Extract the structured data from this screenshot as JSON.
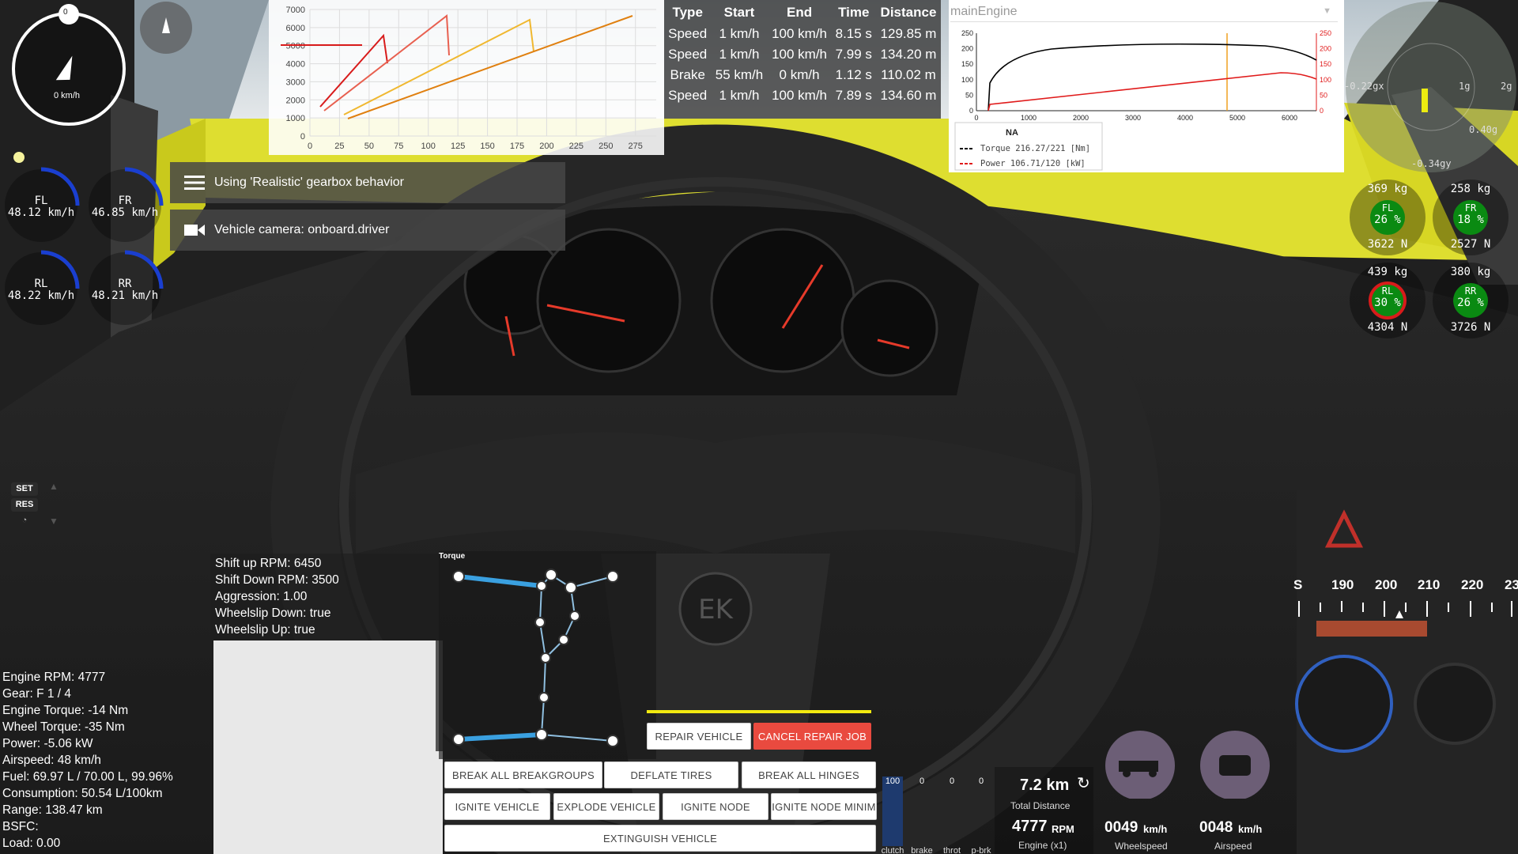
{
  "speedometer": {
    "speed": "0 km/h",
    "gear_marker": "0"
  },
  "shift_chart": {
    "y_ticks": [
      "7000",
      "6000",
      "5000",
      "4000",
      "3000",
      "2000",
      "1000",
      "0"
    ],
    "x_ticks": [
      "0",
      "25",
      "50",
      "75",
      "100",
      "125",
      "150",
      "175",
      "200",
      "225",
      "250",
      "275"
    ]
  },
  "perf_table": {
    "headers": [
      "Type",
      "Start",
      "End",
      "Time",
      "Distance"
    ],
    "rows": [
      [
        "Speed",
        "1 km/h",
        "100 km/h",
        "8.15 s",
        "129.85 m"
      ],
      [
        "Speed",
        "1 km/h",
        "100 km/h",
        "7.99 s",
        "134.20 m"
      ],
      [
        "Brake",
        "55 km/h",
        "0 km/h",
        "1.12 s",
        "110.02 m"
      ],
      [
        "Speed",
        "1 km/h",
        "100 km/h",
        "7.89 s",
        "134.60 m"
      ]
    ]
  },
  "engine_graph": {
    "selector": "mainEngine",
    "left_ticks": [
      "250",
      "200",
      "150",
      "100",
      "50",
      "0"
    ],
    "right_ticks": [
      "250",
      "200",
      "150",
      "100",
      "50",
      "0"
    ],
    "x_ticks": [
      "0",
      "1000",
      "2000",
      "3000",
      "4000",
      "5000",
      "6000"
    ],
    "legend_title": "NA",
    "torque_label": "Torque 216.27/221 [Nm]",
    "power_label": "Power  106.71/120 [kW]",
    "torque_color": "#000000",
    "power_color": "#e01b1b",
    "marker_color": "#f0a020"
  },
  "notifications": [
    {
      "icon": "menu-icon",
      "text": "Using 'Realistic' gearbox behavior"
    },
    {
      "icon": "camera-icon",
      "text": "Vehicle camera: onboard.driver"
    }
  ],
  "wheel_speeds": [
    {
      "pos": "FL",
      "speed": "48.12 km/h"
    },
    {
      "pos": "FR",
      "speed": "46.85 km/h"
    },
    {
      "pos": "RL",
      "speed": "48.22 km/h"
    },
    {
      "pos": "RR",
      "speed": "48.21 km/h"
    }
  ],
  "gforce": {
    "x_label": "-0.22gx",
    "g1": "1g",
    "g2": "2g",
    "right_val": "0.40g",
    "y_label": "-0.34gy"
  },
  "tires": [
    {
      "pos": "FL",
      "mass": "369 kg",
      "pct": "26 %",
      "force": "3622 N"
    },
    {
      "pos": "FR",
      "mass": "258 kg",
      "pct": "18 %",
      "force": "2527 N"
    },
    {
      "pos": "RL",
      "mass": "439 kg",
      "pct": "30 %",
      "force": "4304 N"
    },
    {
      "pos": "RR",
      "mass": "380 kg",
      "pct": "26 %",
      "force": "3726 N"
    }
  ],
  "cruise": {
    "set": "SET",
    "res": "RES"
  },
  "shift_info": [
    "Shift up RPM: 6450",
    "Shift Down RPM: 3500",
    "Aggression: 1.00",
    "Wheelslip Down: true",
    "Wheelslip Up: true"
  ],
  "engine_stats": [
    "Engine RPM: 4777",
    "Gear: F 1 / 4",
    "Engine Torque: -14 Nm",
    "Wheel Torque: -35 Nm",
    "Power: -5.06 kW",
    "Airspeed: 48 km/h",
    "Fuel: 69.97 L / 70.00 L, 99.96%",
    "Consumption: 50.54 L/100km",
    "Range: 138.47 km",
    "BSFC:",
    "Load: 0.00"
  ],
  "node_graph": {
    "title": "Torque"
  },
  "buttons": {
    "repair": "REPAIR VEHICLE",
    "cancel_repair": "CANCEL REPAIR JOB",
    "break_groups": "BREAK ALL BREAKGROUPS",
    "deflate": "DEFLATE TIRES",
    "break_hinges": "BREAK ALL HINGES",
    "ignite_vehicle": "IGNITE VEHICLE",
    "explode": "EXPLODE VEHICLE",
    "ignite_node": "IGNITE NODE",
    "ignite_node_min": "IGNITE NODE MINIM",
    "extinguish": "EXTINGUISH VEHICLE"
  },
  "inputs": [
    {
      "name": "clutch",
      "value": "100",
      "level": 1.0
    },
    {
      "name": "brake",
      "value": "0",
      "level": 0
    },
    {
      "name": "throt",
      "value": "0",
      "level": 0
    },
    {
      "name": "p-brk",
      "value": "0",
      "level": 0
    }
  ],
  "distance": {
    "value": "7.2 km",
    "label": "Total Distance",
    "rpm_val": "4777",
    "rpm_unit": "RPM",
    "rpm_label": "Engine (x1)"
  },
  "wheelspeed_gauge": {
    "value": "0049",
    "unit": "km/h",
    "label": "Wheelspeed"
  },
  "airspeed_gauge": {
    "value": "0048",
    "unit": "km/h",
    "label": "Airspeed"
  },
  "compass": {
    "labels": [
      "S",
      "190",
      "200",
      "210",
      "220",
      "23"
    ]
  }
}
